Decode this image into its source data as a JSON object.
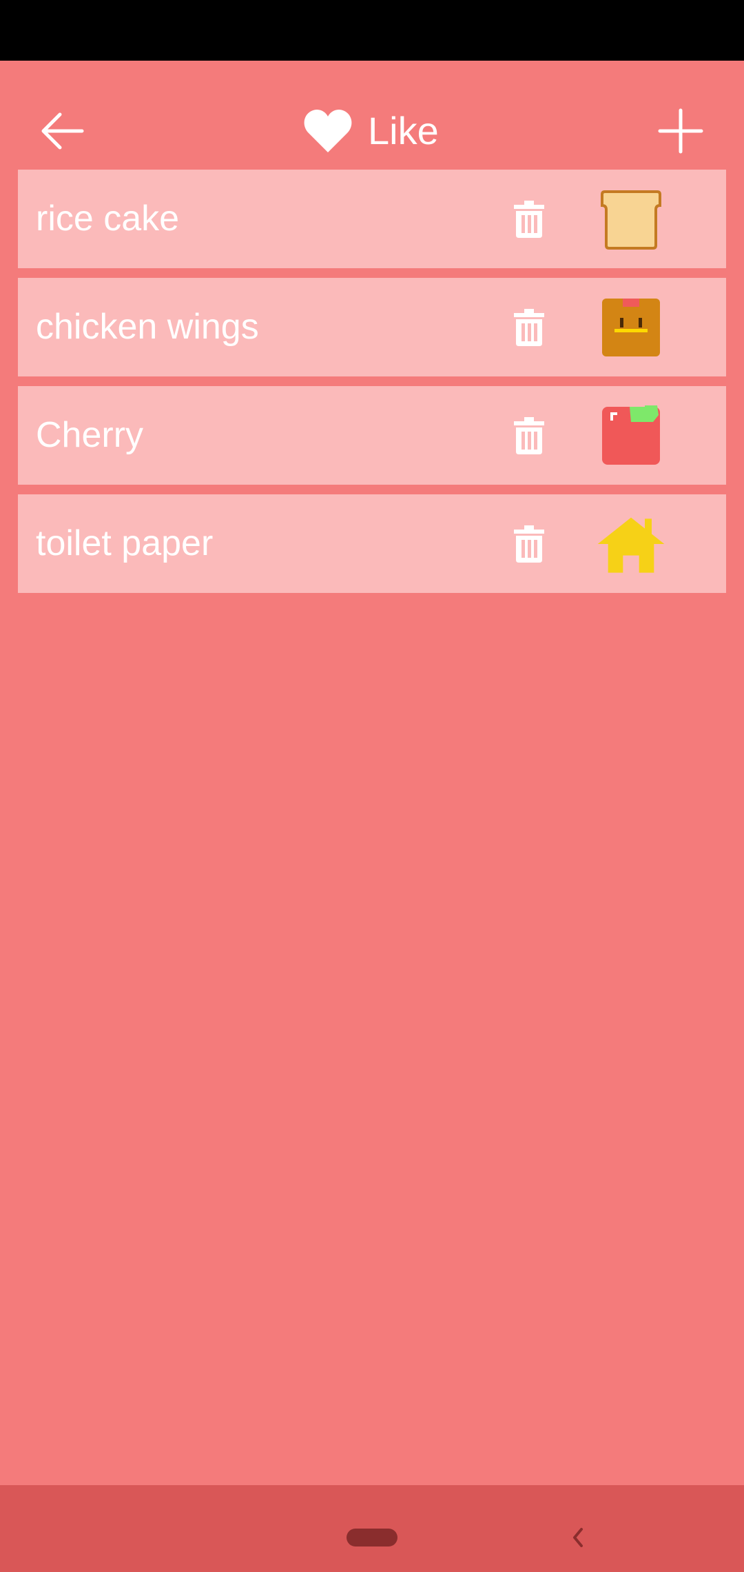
{
  "header": {
    "title": "Like",
    "icons": {
      "back": "arrow-left-icon",
      "title": "heart-icon",
      "add": "plus-icon"
    }
  },
  "items": [
    {
      "label": "rice cake",
      "icon": "bread-icon"
    },
    {
      "label": "chicken wings",
      "icon": "food-box-icon"
    },
    {
      "label": "Cherry",
      "icon": "cherry-icon"
    },
    {
      "label": "toilet paper",
      "icon": "house-icon"
    }
  ],
  "item_action_icon": "trash-icon",
  "nav": {
    "home": "home-pill",
    "back": "chevron-left-icon"
  },
  "colors": {
    "background": "#f47b7b",
    "list_item": "#fbbaba",
    "nav_bar": "#d95757",
    "status_bar": "#000000",
    "text": "#ffffff"
  }
}
